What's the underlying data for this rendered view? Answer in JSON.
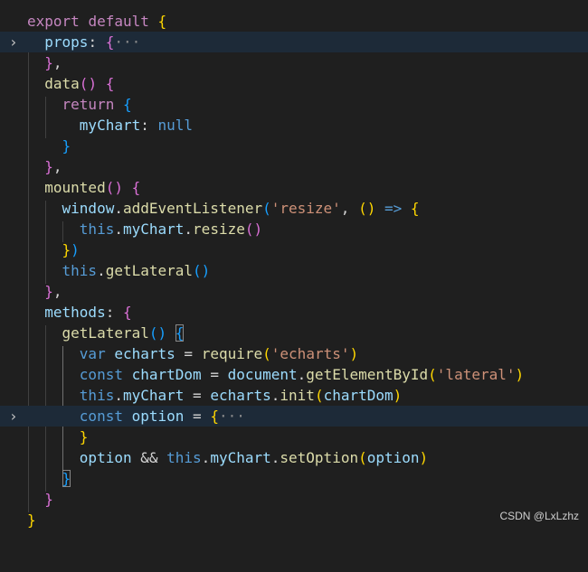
{
  "editor": {
    "lines": [
      {
        "t": [
          "export",
          "default",
          "{"
        ]
      },
      {
        "t": [
          "props",
          ":",
          "{",
          "···"
        ]
      },
      {
        "t": [
          "}",
          ","
        ]
      },
      {
        "t": [
          "data",
          "(",
          ")",
          "{"
        ]
      },
      {
        "t": [
          "return",
          "{"
        ]
      },
      {
        "t": [
          "myChart",
          ":",
          "null"
        ]
      },
      {
        "t": [
          "}"
        ]
      },
      {
        "t": [
          "}",
          ","
        ]
      },
      {
        "t": [
          "mounted",
          "(",
          ")",
          "{"
        ]
      },
      {
        "t": [
          "window",
          ".",
          "addEventListener",
          "(",
          "'resize'",
          ",",
          "(",
          ")",
          "=>",
          "{"
        ]
      },
      {
        "t": [
          "this",
          ".",
          "myChart",
          ".",
          "resize",
          "(",
          ")"
        ]
      },
      {
        "t": [
          "}",
          ")"
        ]
      },
      {
        "t": [
          "this",
          ".",
          "getLateral",
          "(",
          ")"
        ]
      },
      {
        "t": [
          "}",
          ","
        ]
      },
      {
        "t": [
          "methods",
          ":",
          "{"
        ]
      },
      {
        "t": [
          "getLateral",
          "(",
          ")",
          "{"
        ]
      },
      {
        "t": [
          "var",
          "echarts",
          "=",
          "require",
          "(",
          "'echarts'",
          ")"
        ]
      },
      {
        "t": [
          "const",
          "chartDom",
          "=",
          "document",
          ".",
          "getElementById",
          "(",
          "'lateral'",
          ")"
        ]
      },
      {
        "t": [
          "this",
          ".",
          "myChart",
          "=",
          "echarts",
          ".",
          "init",
          "(",
          "chartDom",
          ")"
        ]
      },
      {
        "t": [
          "const",
          "option",
          "=",
          "{",
          "···"
        ]
      },
      {
        "t": [
          "}"
        ]
      },
      {
        "t": [
          "option",
          "&&",
          "this",
          ".",
          "myChart",
          ".",
          "setOption",
          "(",
          "option",
          ")"
        ]
      },
      {
        "t": [
          "}"
        ]
      },
      {
        "t": [
          "}"
        ]
      },
      {
        "t": [
          "}"
        ]
      }
    ],
    "gutter": {
      "fold_icon": "chevron-right-icon",
      "fold_glyph": "›"
    }
  },
  "watermark": "CSDN @LxLzhz",
  "colors": {
    "background": "#1f1f1f",
    "folded_line_highlight": "#1d2a38",
    "keyword": "#c586c0",
    "keyword_blue": "#569cd6",
    "function": "#dcdcaa",
    "variable": "#9cdcfe",
    "string": "#ce9178",
    "bracket_level_1": "#ffd700",
    "bracket_level_2": "#da70d6",
    "bracket_level_3": "#179fff"
  }
}
